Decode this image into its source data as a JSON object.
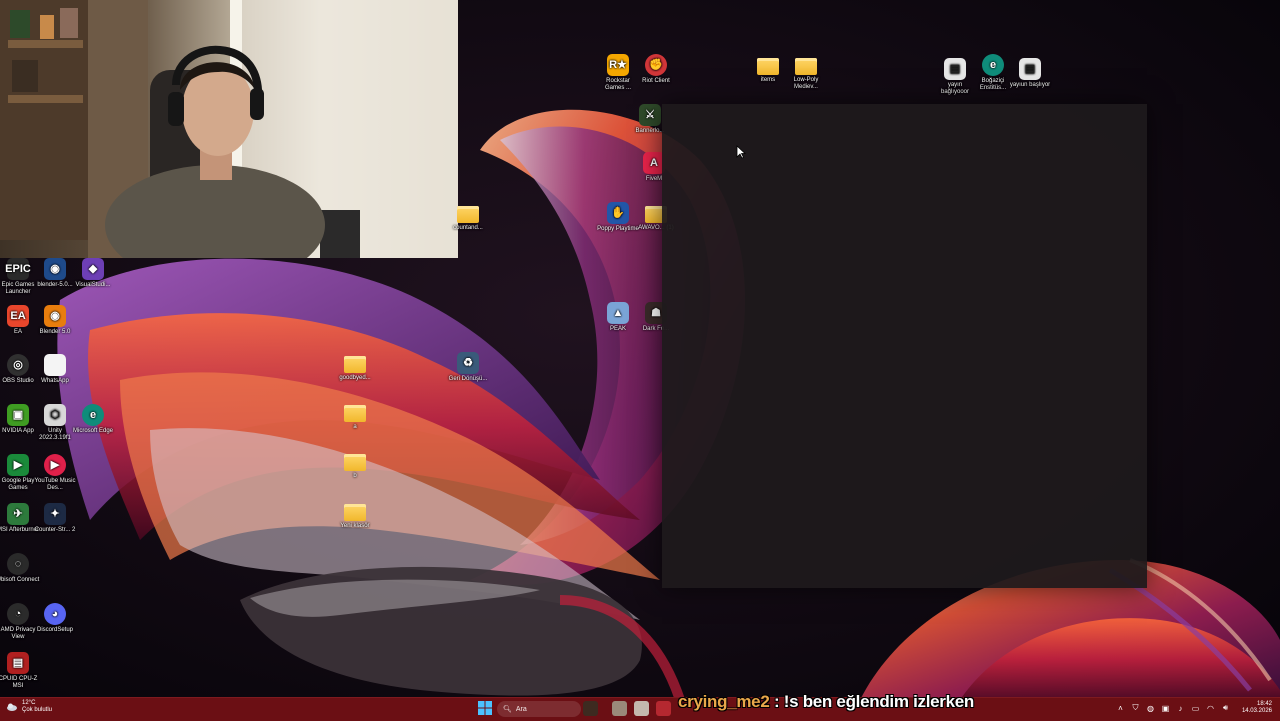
{
  "webcam": {
    "label": ""
  },
  "desktop_icons": [
    {
      "id": "epic",
      "label": "Epic Games Launcher",
      "glyph": "EPIC",
      "color": "#2a2a2a"
    },
    {
      "id": "blender50a",
      "label": "blender-5.0...",
      "glyph": "◉",
      "color": "#1e4a8a"
    },
    {
      "id": "visualstudio",
      "label": "VisualStudi...",
      "glyph": "◆",
      "color": "#6d3fb5"
    },
    {
      "id": "ea",
      "label": "EA",
      "glyph": "EA",
      "color": "#e8462c"
    },
    {
      "id": "blender50",
      "label": "Blender 5.0",
      "glyph": "◉",
      "color": "#e87d0d"
    },
    {
      "id": "obs",
      "label": "OBS Studio",
      "glyph": "◎",
      "color": "#303030"
    },
    {
      "id": "whatsapp",
      "label": "WhatsApp",
      "glyph": "",
      "color": "#f4f4f4"
    },
    {
      "id": "nvidia",
      "label": "NVIDIA App",
      "glyph": "▣",
      "color": "#3f9d22"
    },
    {
      "id": "unity",
      "label": "Unity 2022.3.19f1",
      "glyph": "⬡",
      "color": "#d8d8d8"
    },
    {
      "id": "edge",
      "label": "Microsoft Edge",
      "glyph": "e",
      "color": "#0f8c7a"
    },
    {
      "id": "googleplay",
      "label": "Google Play Games",
      "glyph": "▶",
      "color": "#1a8a3a"
    },
    {
      "id": "ytmusic",
      "label": "YouTube Music Des...",
      "glyph": "▶",
      "color": "#e0204a"
    },
    {
      "id": "msiafter",
      "label": "MSI Afterburner",
      "glyph": "✈",
      "color": "#2d7a3c"
    },
    {
      "id": "cs2",
      "label": "Counter-Str... 2",
      "glyph": "✦",
      "color": "#1d2a44"
    },
    {
      "id": "ubisoft",
      "label": "Ubisoft Connect",
      "glyph": "◌",
      "color": "#2a2a2a"
    },
    {
      "id": "amdprivacy",
      "label": "AMD Privacy View",
      "glyph": "◔",
      "color": "#2b2b2b"
    },
    {
      "id": "discordsetup",
      "label": "DiscordSetup",
      "glyph": "◕",
      "color": "#5865f2"
    },
    {
      "id": "cpuid",
      "label": "CPUID CPU-Z MSI",
      "glyph": "▤",
      "color": "#b02020"
    },
    {
      "id": "goodbye",
      "label": "goodbyed...",
      "glyph": "folder",
      "color": ""
    },
    {
      "id": "folder_a",
      "label": "a",
      "glyph": "folder",
      "color": ""
    },
    {
      "id": "folder_b",
      "label": "b",
      "glyph": "folder",
      "color": ""
    },
    {
      "id": "yeniklasor",
      "label": "Yeni klasör",
      "glyph": "folder",
      "color": ""
    },
    {
      "id": "geridonusum",
      "label": "Geri Dönüşü...",
      "glyph": "♻",
      "color": "#3a5a7a"
    },
    {
      "id": "countand",
      "label": "countand...",
      "glyph": "folder",
      "color": ""
    },
    {
      "id": "rockstar",
      "label": "Rockstar Games ...",
      "glyph": "R★",
      "color": "#f5a700"
    },
    {
      "id": "riot",
      "label": "Riot Client",
      "glyph": "✊",
      "color": "#d13639"
    },
    {
      "id": "bannerlord",
      "label": "Bannerlo...",
      "glyph": "⚔",
      "color": "#2f4a2a"
    },
    {
      "id": "fivem",
      "label": "FiveM",
      "glyph": "A",
      "color": "#e8234a"
    },
    {
      "id": "poppy",
      "label": "Poppy Playtime",
      "glyph": "✋",
      "color": "#2256a8"
    },
    {
      "id": "awavo",
      "label": "AWAVO... (1)",
      "glyph": "folder",
      "color": ""
    },
    {
      "id": "peak",
      "label": "PEAK",
      "glyph": "▲",
      "color": "#7aa4d6"
    },
    {
      "id": "darkfo",
      "label": "Dark Fo...",
      "glyph": "☗",
      "color": "#3a2a2a"
    },
    {
      "id": "items",
      "label": "items",
      "glyph": "folder",
      "color": ""
    },
    {
      "id": "lowpoly",
      "label": "Low-Poly Mediev...",
      "glyph": "folder",
      "color": ""
    },
    {
      "id": "yayinbaglyoor",
      "label": "yayın bağlıyooor",
      "glyph": "▤",
      "color": "#e6e6e6"
    },
    {
      "id": "bogazici",
      "label": "Boğaziçi Enstitüs...",
      "glyph": "e",
      "color": "#0f8c7a"
    },
    {
      "id": "yayinbasliyor",
      "label": "yayıun başlıyor",
      "glyph": "▤",
      "color": "#e6e6e6"
    }
  ],
  "taskbar": {
    "weather_temp": "12°C",
    "weather_desc": "Çok bulutlu",
    "search_placeholder": "Ara",
    "time": "18:42",
    "date": "14.03.2026"
  },
  "chat": {
    "user": "crying_me2",
    "separator": ":",
    "message": "!s ben eğlendim izlerken"
  },
  "colors": {
    "taskbar": "#6b0f14",
    "accent": "#e9a84a"
  },
  "tray_icons": [
    "chevron-up-icon",
    "shield-icon",
    "network-icon",
    "gpu-icon",
    "mic-icon",
    "monitor-icon",
    "wifi-icon",
    "volume-icon"
  ]
}
